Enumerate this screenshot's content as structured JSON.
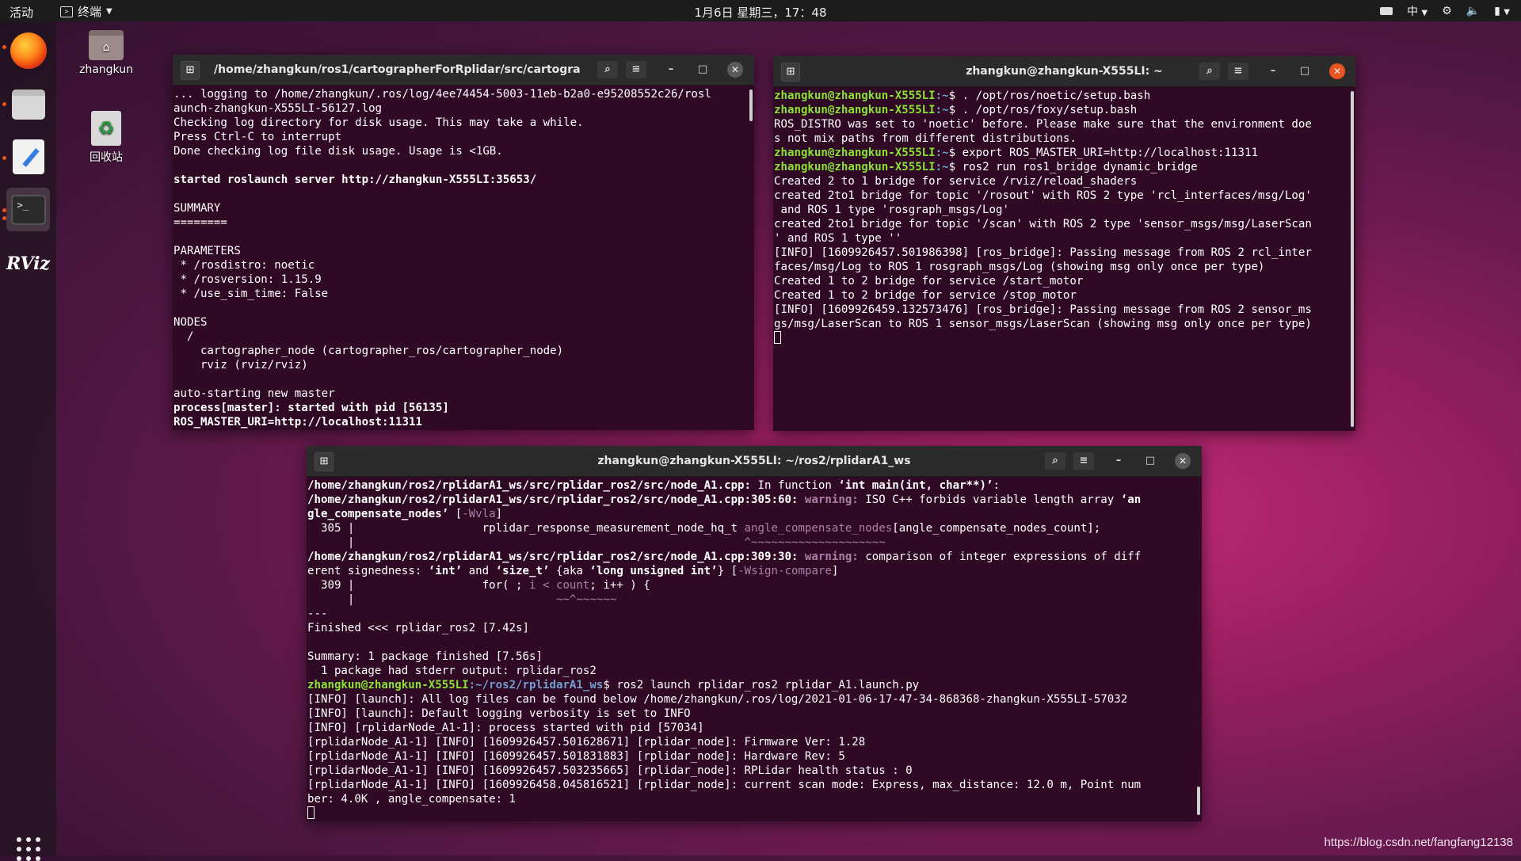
{
  "topbar": {
    "activities": "活动",
    "app_name": "终端",
    "clock": "1月6日 星期三，17：48",
    "input_method": "中"
  },
  "desktop": {
    "home_label": "zhangkun",
    "trash_label": "回收站"
  },
  "windows": {
    "w1": {
      "title": "/home/zhangkun/ros1/cartographerForRplidar/src/cartographe...",
      "lines": [
        {
          "t": "... logging to /home/zhangkun/.ros/log/4ee74454-5003-11eb-b2a0-e95208552c26/rosl"
        },
        {
          "t": "aunch-zhangkun-X555LI-56127.log"
        },
        {
          "t": "Checking log directory for disk usage. This may take a while."
        },
        {
          "t": "Press Ctrl-C to interrupt"
        },
        {
          "t": "Done checking log file disk usage. Usage is <1GB."
        },
        {
          "t": ""
        },
        {
          "t": "started roslaunch server http://zhangkun-X555LI:35653/",
          "b": true
        },
        {
          "t": ""
        },
        {
          "t": "SUMMARY"
        },
        {
          "t": "========"
        },
        {
          "t": ""
        },
        {
          "t": "PARAMETERS"
        },
        {
          "t": " * /rosdistro: noetic"
        },
        {
          "t": " * /rosversion: 1.15.9"
        },
        {
          "t": " * /use_sim_time: False"
        },
        {
          "t": ""
        },
        {
          "t": "NODES"
        },
        {
          "t": "  /"
        },
        {
          "t": "    cartographer_node (cartographer_ros/cartographer_node)"
        },
        {
          "t": "    rviz (rviz/rviz)"
        },
        {
          "t": ""
        },
        {
          "t": "auto-starting new master"
        },
        {
          "t": "process[master]: started with pid [56135]",
          "b": true
        },
        {
          "t": "ROS_MASTER_URI=http://localhost:11311",
          "b": true
        }
      ]
    },
    "w2": {
      "title": "zhangkun@zhangkun-X555LI: ~",
      "prompt_user": "zhangkun@zhangkun-X555LI",
      "prompt_path": ":~",
      "lines": [
        {
          "p": true,
          "t": "$ . /opt/ros/noetic/setup.bash"
        },
        {
          "p": true,
          "t": "$ . /opt/ros/foxy/setup.bash"
        },
        {
          "t": "ROS_DISTRO was set to 'noetic' before. Please make sure that the environment doe"
        },
        {
          "t": "s not mix paths from different distributions."
        },
        {
          "p": true,
          "t": "$ export ROS_MASTER_URI=http://localhost:11311"
        },
        {
          "p": true,
          "t": "$ ros2 run ros1_bridge dynamic_bridge"
        },
        {
          "t": "Created 2 to 1 bridge for service /rviz/reload_shaders"
        },
        {
          "t": "created 2to1 bridge for topic '/rosout' with ROS 2 type 'rcl_interfaces/msg/Log'"
        },
        {
          "t": " and ROS 1 type 'rosgraph_msgs/Log'"
        },
        {
          "t": "created 2to1 bridge for topic '/scan' with ROS 2 type 'sensor_msgs/msg/LaserScan"
        },
        {
          "t": "' and ROS 1 type ''"
        },
        {
          "t": "[INFO] [1609926457.501986398] [ros_bridge]: Passing message from ROS 2 rcl_inter"
        },
        {
          "t": "faces/msg/Log to ROS 1 rosgraph_msgs/Log (showing msg only once per type)"
        },
        {
          "t": "Created 1 to 2 bridge for service /start_motor"
        },
        {
          "t": "Created 1 to 2 bridge for service /stop_motor"
        },
        {
          "t": "[INFO] [1609926459.132573476] [ros_bridge]: Passing message from ROS 2 sensor_ms"
        },
        {
          "t": "gs/msg/LaserScan to ROS 1 sensor_msgs/LaserScan (showing msg only once per type)"
        }
      ]
    },
    "w3": {
      "title": "zhangkun@zhangkun-X555LI: ~/ros2/rplidarA1_ws",
      "prompt_user": "zhangkun@zhangkun-X555LI",
      "prompt_path": ":~/ros2/rplidarA1_ws",
      "lines": [
        {
          "s": [
            {
              "t": "/home/zhangkun/ros2/rplidarA1_ws/src/rplidar_ros2/src/node_A1.cpp:",
              "c": "bold"
            },
            {
              "t": " In function "
            },
            {
              "t": "‘int main(int, char**)’",
              "c": "bold"
            },
            {
              "t": ":"
            }
          ]
        },
        {
          "s": [
            {
              "t": "/home/zhangkun/ros2/rplidarA1_ws/src/rplidar_ros2/src/node_A1.cpp:305:60:",
              "c": "bold"
            },
            {
              "t": " warning:",
              "c": "warn"
            },
            {
              "t": " ISO C++ forbids variable length array "
            },
            {
              "t": "‘an",
              "c": "bold"
            }
          ]
        },
        {
          "s": [
            {
              "t": "gle_compensate_nodes’",
              "c": "bold"
            },
            {
              "t": " ["
            },
            {
              "t": "-Wvla",
              "c": "dim"
            },
            {
              "t": "]"
            }
          ]
        },
        {
          "s": [
            {
              "t": "  305 |                   rplidar_response_measurement_node_hq_t "
            },
            {
              "t": "angle_compensate_nodes",
              "c": "dim"
            },
            {
              "t": "[angle_compensate_nodes_count];"
            }
          ]
        },
        {
          "s": [
            {
              "t": "      |                                                          "
            },
            {
              "t": "^~~~~~~~~~~~~~~~~~~~~",
              "c": "dim"
            }
          ]
        },
        {
          "s": [
            {
              "t": "/home/zhangkun/ros2/rplidarA1_ws/src/rplidar_ros2/src/node_A1.cpp:309:30:",
              "c": "bold"
            },
            {
              "t": " warning:",
              "c": "warn"
            },
            {
              "t": " comparison of integer expressions of diff"
            }
          ]
        },
        {
          "s": [
            {
              "t": "erent signedness: "
            },
            {
              "t": "‘int’",
              "c": "bold"
            },
            {
              "t": " and "
            },
            {
              "t": "‘size_t’",
              "c": "bold"
            },
            {
              "t": " {aka "
            },
            {
              "t": "‘long unsigned int’",
              "c": "bold"
            },
            {
              "t": "} ["
            },
            {
              "t": "-Wsign-compare",
              "c": "dim"
            },
            {
              "t": "]"
            }
          ]
        },
        {
          "s": [
            {
              "t": "  309 |                   for( ; "
            },
            {
              "t": "i < count",
              "c": "dim"
            },
            {
              "t": "; i++ ) {"
            }
          ]
        },
        {
          "s": [
            {
              "t": "      |                              "
            },
            {
              "t": "~~^~~~~~~",
              "c": "dim"
            }
          ]
        },
        {
          "s": [
            {
              "t": "---"
            }
          ]
        },
        {
          "s": [
            {
              "t": "Finished <<< rplidar_ros2 [7.42s]"
            }
          ]
        },
        {
          "s": [
            {
              "t": ""
            }
          ]
        },
        {
          "s": [
            {
              "t": "Summary: 1 package finished [7.56s]"
            }
          ]
        },
        {
          "s": [
            {
              "t": "  1 package had stderr output: rplidar_ros2"
            }
          ]
        },
        {
          "s": [
            {
              "t": "zhangkun@zhangkun-X555LI",
              "c": "prompt-user"
            },
            {
              "t": ":~/ros2/rplidarA1_ws",
              "c": "prompt-path"
            },
            {
              "t": "$ ros2 launch rplidar_ros2 rplidar_A1.launch.py"
            }
          ]
        },
        {
          "s": [
            {
              "t": "[INFO] [launch]: All log files can be found below /home/zhangkun/.ros/log/2021-01-06-17-47-34-868368-zhangkun-X555LI-57032"
            }
          ]
        },
        {
          "s": [
            {
              "t": "[INFO] [launch]: Default logging verbosity is set to INFO"
            }
          ]
        },
        {
          "s": [
            {
              "t": "[INFO] [rplidarNode_A1-1]: process started with pid [57034]"
            }
          ]
        },
        {
          "s": [
            {
              "t": "[rplidarNode_A1-1] [INFO] [1609926457.501628671] [rplidar_node]: Firmware Ver: 1.28"
            }
          ]
        },
        {
          "s": [
            {
              "t": "[rplidarNode_A1-1] [INFO] [1609926457.501831883] [rplidar_node]: Hardware Rev: 5"
            }
          ]
        },
        {
          "s": [
            {
              "t": "[rplidarNode_A1-1] [INFO] [1609926457.503235665] [rplidar_node]: RPLidar health status : 0"
            }
          ]
        },
        {
          "s": [
            {
              "t": "[rplidarNode_A1-1] [INFO] [1609926458.045816521] [rplidar_node]: current scan mode: Express, max_distance: 12.0 m, Point num"
            }
          ]
        },
        {
          "s": [
            {
              "t": "ber: 4.0K , angle_compensate: 1"
            }
          ]
        }
      ]
    }
  },
  "watermark": "https://blog.csdn.net/fangfang12138",
  "icons": {
    "new_tab": "new-tab-icon",
    "search": "search-icon",
    "menu": "hamburger-menu-icon",
    "minimize": "minimize-icon",
    "maximize": "maximize-icon",
    "close": "close-icon"
  },
  "colors": {
    "terminal_bg": "#300a24",
    "prompt_green": "#8ae234",
    "prompt_blue": "#729fcf",
    "close_focused": "#e95420"
  }
}
